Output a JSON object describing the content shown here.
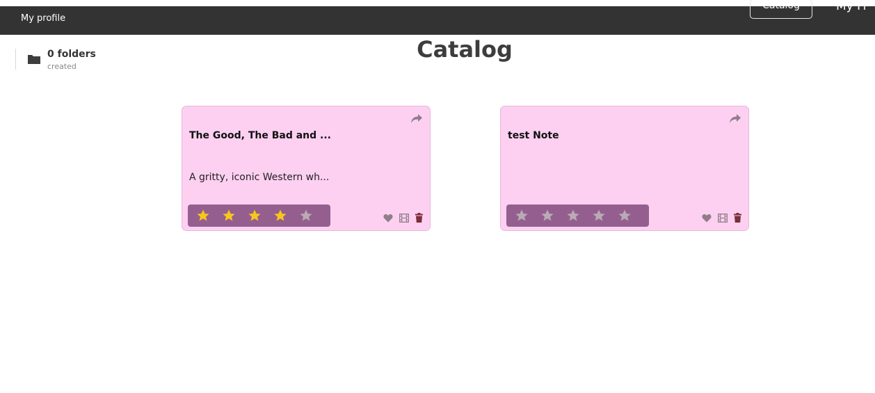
{
  "nav": {
    "profile_label": "My profile",
    "catalog_label": "Catalog",
    "myfi_label": "My Fi"
  },
  "folders": {
    "count_label": "0 folders",
    "sub_label": "created"
  },
  "page": {
    "title": "Catalog"
  },
  "cards": [
    {
      "title": "The Good, The Bad and ...",
      "description": "A gritty, iconic Western wh...",
      "rating": 4,
      "max_rating": 5
    },
    {
      "title": "test Note",
      "description": "",
      "rating": 0,
      "max_rating": 5
    }
  ],
  "colors": {
    "nav_bg": "#333333",
    "card_bg": "#fdd0f1",
    "rating_bg": "#945f8e",
    "star_filled": "#f7c61c",
    "star_empty": "#b9aab5",
    "icon_gray": "#8f7e8a"
  },
  "icons": {
    "folder": "folder-icon",
    "share": "share-arrow-icon",
    "favorite": "heart-icon",
    "film": "film-icon",
    "delete": "trash-icon",
    "star": "star-icon"
  }
}
